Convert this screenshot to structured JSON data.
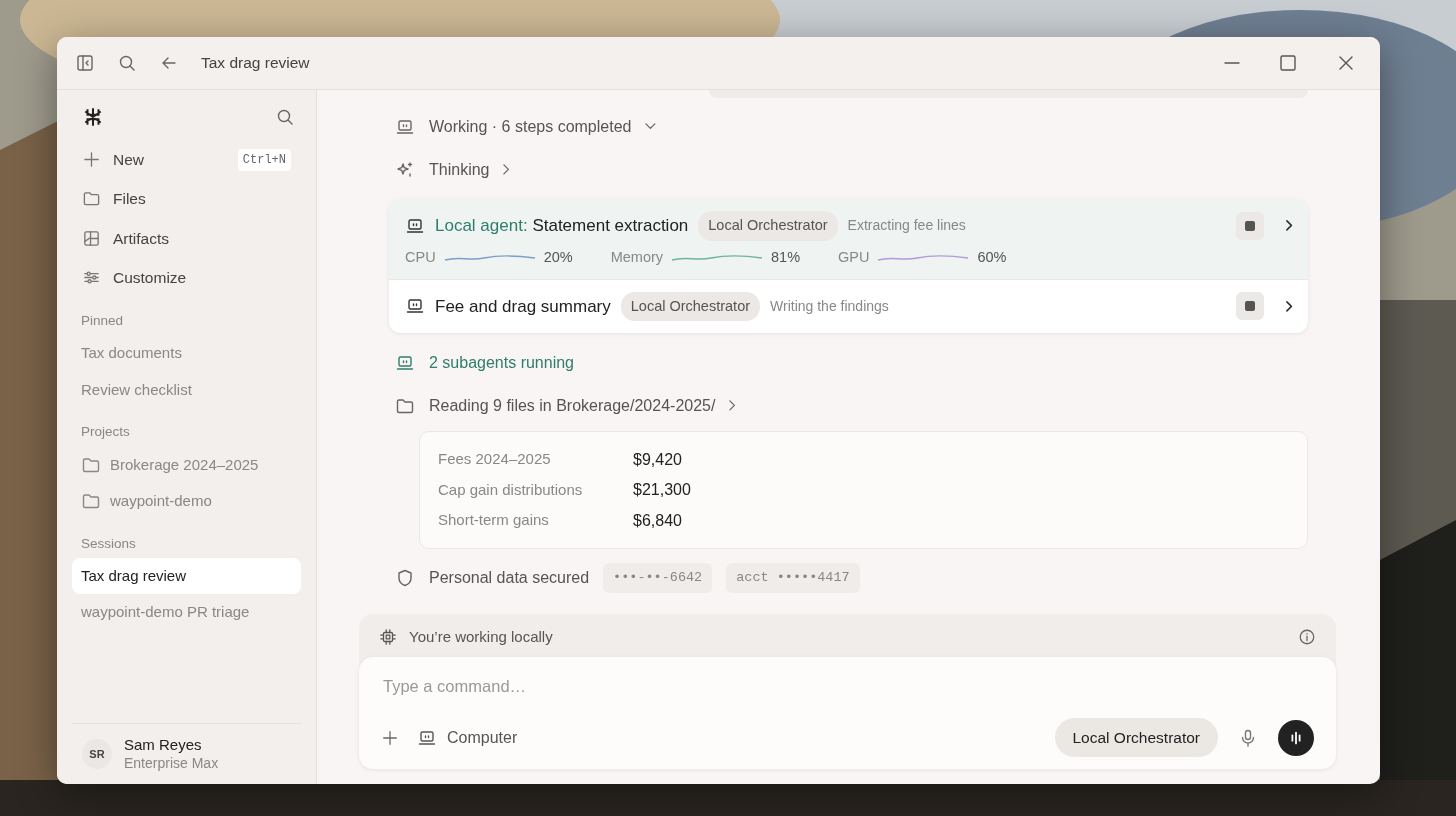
{
  "window": {
    "title": "Tax drag review"
  },
  "sidebar": {
    "nav": [
      {
        "kind": "plus",
        "label": "New",
        "shortcut": "Ctrl+N"
      },
      {
        "kind": "folder",
        "label": "Files"
      },
      {
        "kind": "artifacts",
        "label": "Artifacts"
      },
      {
        "kind": "sliders",
        "label": "Customize"
      }
    ],
    "sections": [
      {
        "heading": "Pinned",
        "items": [
          {
            "label": "Tax documents"
          },
          {
            "label": "Review checklist"
          }
        ]
      },
      {
        "heading": "Projects",
        "items": [
          {
            "label": "Brokerage 2024–2025",
            "kind": "folder"
          },
          {
            "label": "waypoint-demo",
            "kind": "folder"
          }
        ]
      },
      {
        "heading": "Sessions",
        "items": [
          {
            "label": "Tax drag review",
            "selected": true
          },
          {
            "label": "waypoint-demo PR triage",
            "selected": false
          }
        ]
      }
    ],
    "user": {
      "initials": "SR",
      "name": "Sam Reyes",
      "plan": "Enterprise Max"
    }
  },
  "steps": [
    {
      "kind": "computer",
      "text": "Working · 6 steps completed",
      "expanded": true
    },
    {
      "kind": "sparkle",
      "text": "Thinking",
      "expanded": false
    }
  ],
  "agents": [
    {
      "selected": true,
      "prefix": "Local agent:",
      "title": "Statement extraction",
      "orchestrator": "Local Orchestrator",
      "status": "Extracting fee lines",
      "metrics": [
        {
          "label": "CPU",
          "value": "20%",
          "color": "#7fa0c4"
        },
        {
          "label": "Memory",
          "value": "81%",
          "color": "#6fb3a0"
        },
        {
          "label": "GPU",
          "value": "60%",
          "color": "#b49ad8"
        }
      ]
    },
    {
      "selected": false,
      "title": "Fee and drag summary",
      "orchestrator": "Local Orchestrator",
      "status": "Writing the findings"
    }
  ],
  "subagents": "2 subagents running",
  "reading": "Reading 9 files in Brokerage/2024-2025/",
  "facts": [
    {
      "label": "Fees 2024–2025",
      "value": "$9,420"
    },
    {
      "label": "Cap gain distributions",
      "value": "$21,300"
    },
    {
      "label": "Short-term gains",
      "value": "$6,840"
    }
  ],
  "privacy": {
    "label": "Personal data secured",
    "tokens": [
      "•••-••-6642",
      "acct •••••4417"
    ]
  },
  "banner": "You’re working locally",
  "composer": {
    "placeholder": "Type a command…",
    "tool": "Computer",
    "model": "Local Orchestrator"
  }
}
